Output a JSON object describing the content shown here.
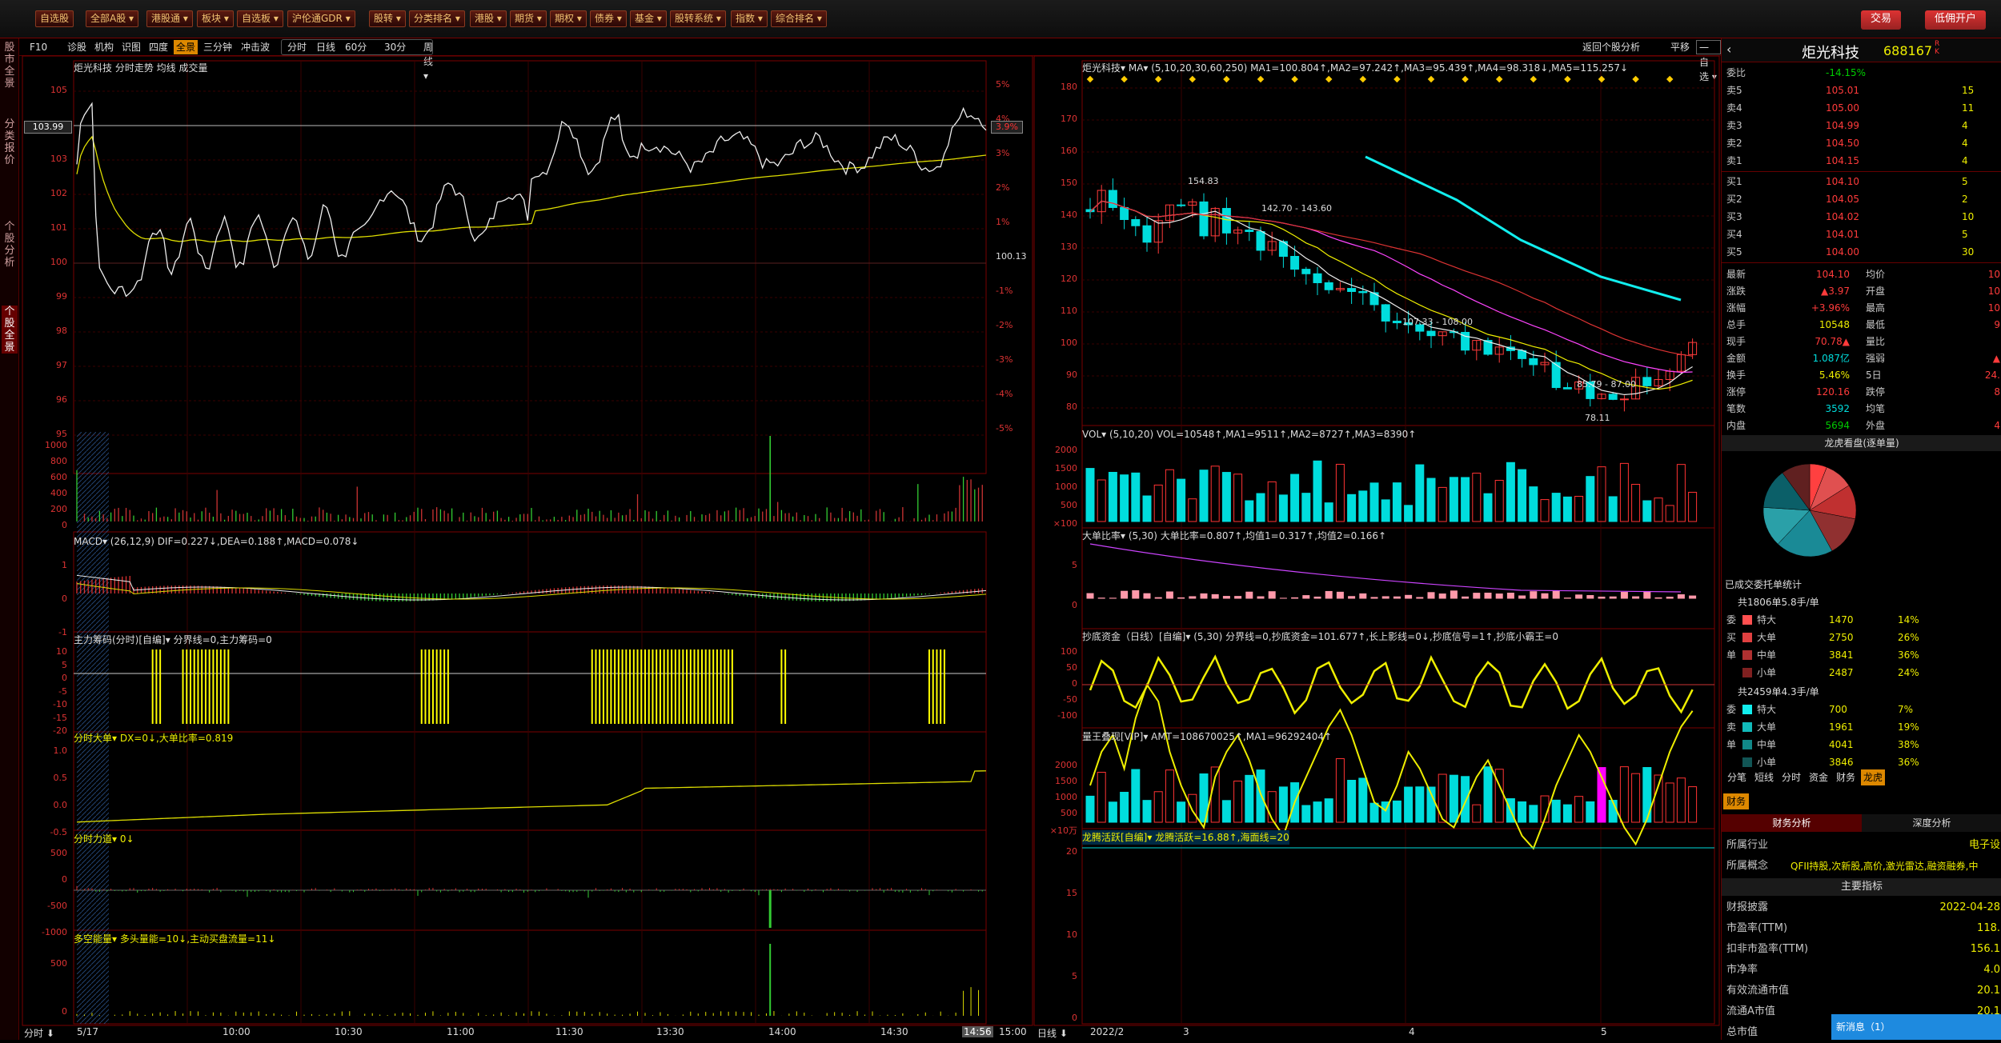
{
  "menu": [
    "自选股",
    "全部A股",
    "港股通",
    "板块",
    "自选板",
    "沪伦通GDR",
    "股转",
    "分类排名",
    "港股",
    "期货",
    "期权",
    "债券",
    "基金",
    "股转系统",
    "指数",
    "综合排名"
  ],
  "menu_right": [
    "交易",
    "低佣开户"
  ],
  "sidebar_tabs": [
    "股市全景",
    "分类报价",
    "个股分析",
    "个股全景"
  ],
  "toolbar_left": [
    "F10",
    "诊股",
    "机构",
    "识图",
    "四度",
    "全景",
    "三分钟",
    "冲击波"
  ],
  "toolbar_active": "全景",
  "toolbar_mid": [
    "分时",
    "日线",
    "60分",
    "30分",
    "周线"
  ],
  "toolbar_right": [
    "返回个股分析",
    "平移",
    "一自选"
  ],
  "stock": {
    "name": "炬光科技",
    "code": "688167",
    "badge": "R K"
  },
  "intraday": {
    "head": "炬光科技  分时走势  均线 成交量",
    "price_ticks": [
      "105",
      "104",
      "103",
      "102",
      "101",
      "100",
      "99",
      "98",
      "97",
      "96",
      "95"
    ],
    "pct_ticks": [
      "5%",
      "4%",
      "3%",
      "2%",
      "1%",
      "100.13",
      "-1%",
      "-2%",
      "-3%",
      "-4%",
      "-5%"
    ],
    "current": "103.99",
    "current_pct": "3.9%",
    "vol_ticks": [
      "1000",
      "800",
      "600",
      "400",
      "200",
      "0"
    ],
    "macd_head": "MACD▾ (26,12,9)  DIF=0.227↓,DEA=0.188↑,MACD=0.078↓",
    "macd_ticks": [
      "1",
      "0",
      "-1"
    ],
    "zlcm_head": "主力筹码(分时)[自编]▾  分界线=0,主力筹码=0",
    "zlcm_ticks": [
      "10",
      "5",
      "0",
      "-5",
      "-10",
      "-15",
      "-20"
    ],
    "dd_head": "分时大单▾  DX=0↓,大单比率=0.819",
    "dd_ticks": [
      "1.0",
      "0.5",
      "0.0",
      "-0.5"
    ],
    "ld_head": "分时力道▾  0↓",
    "ld_ticks": [
      "500",
      "0",
      "-500",
      "-1000"
    ],
    "dk_head": "多空能量▾  多头量能=10↓,主动买盘流量=11↓",
    "dk_ticks": [
      "500",
      "0"
    ],
    "xaxis": [
      "分时 ⬇",
      "5/17",
      "10:00",
      "10:30",
      "11:00",
      "11:30",
      "13:30",
      "14:00",
      "14:30",
      "14:56",
      "15:00"
    ]
  },
  "daily": {
    "head": "炬光科技▾  MA▾ (5,10,20,30,60,250)  MA1=100.804↑,MA2=97.242↑,MA3=95.439↑,MA4=98.318↓,MA5=115.257↓",
    "price_ticks": [
      "180",
      "170",
      "160",
      "150",
      "140",
      "130",
      "120",
      "110",
      "100",
      "90",
      "80"
    ],
    "annot": [
      "154.83",
      "142.70 - 143.60",
      "107.33 - 108.00",
      "85.79 - 87.00",
      "78.11"
    ],
    "vol_head": "VOL▾ (5,10,20)  VOL=10548↑,MA1=9511↑,MA2=8727↑,MA3=8390↑",
    "vol_ticks": [
      "2000",
      "1500",
      "1000",
      "500",
      "×100"
    ],
    "ddbl_head": "大单比率▾ (5,30)  大单比率=0.807↑,均值1=0.317↑,均值2=0.166↑",
    "ddbl_ticks": [
      "5",
      "0"
    ],
    "cdzj_head": "抄底资金（日线）[自编]▾ (5,30)  分界线=0,抄底资金=101.677↑,长上影线=0↓,抄底信号=1↑,抄底小霸王=0",
    "cdzj_ticks": [
      "100",
      "50",
      "0",
      "-50",
      "-100"
    ],
    "lw_head": "量王叠现[VIP]▾  AMT=108670025↑,MA1=96292404↑",
    "lw_ticks": [
      "2000",
      "1500",
      "1000",
      "500",
      "×10万"
    ],
    "lt_head": "龙腾活跃[自编]▾  龙腾活跃=16.88↑,海面线=20",
    "lt_ticks": [
      "20",
      "15",
      "10",
      "5",
      "0"
    ],
    "xaxis": [
      "日线 ⬇",
      "2022/2",
      "3",
      "4",
      "5"
    ]
  },
  "orderbook": {
    "weibi_label": "委比",
    "weibi": "-14.15%",
    "asks": [
      [
        "卖5",
        "105.01",
        "15"
      ],
      [
        "卖4",
        "105.00",
        "11"
      ],
      [
        "卖3",
        "104.99",
        "4"
      ],
      [
        "卖2",
        "104.50",
        "4"
      ],
      [
        "卖1",
        "104.15",
        "4"
      ]
    ],
    "bids": [
      [
        "买1",
        "104.10",
        "5"
      ],
      [
        "买2",
        "104.05",
        "2"
      ],
      [
        "买3",
        "104.02",
        "10"
      ],
      [
        "买4",
        "104.01",
        "5"
      ],
      [
        "买5",
        "104.00",
        "30"
      ]
    ]
  },
  "stats": [
    [
      "最新",
      "104.10",
      "均价",
      "10"
    ],
    [
      "涨跌",
      "▲3.97",
      "开盘",
      "10"
    ],
    [
      "涨幅",
      "+3.96%",
      "最高",
      "10"
    ],
    [
      "总手",
      "10548",
      "最低",
      "9"
    ],
    [
      "现手",
      "70.78▲",
      "量比",
      ""
    ],
    [
      "金额",
      "1.087亿",
      "强弱",
      "▲"
    ],
    [
      "换手",
      "5.46%",
      "5日",
      "24."
    ],
    [
      "涨停",
      "120.16",
      "跌停",
      "8"
    ],
    [
      "笔数",
      "3592",
      "均笔",
      ""
    ],
    [
      "内盘",
      "5694",
      "外盘",
      "4"
    ]
  ],
  "lhb_title": "龙虎看盘(逐单量)",
  "pie_colors": [
    "#ff4040",
    "#e05050",
    "#c03030",
    "#903030",
    "#1a8a96",
    "#2aa0a8",
    "#0b5f68",
    "#602020"
  ],
  "delegation": {
    "title": "已成交委托单统计",
    "buy_head": "共1806单5.8手/单",
    "sell_head": "共2459单4.3手/单",
    "buy": [
      [
        "委",
        "特大",
        "1470",
        "14%"
      ],
      [
        "买",
        "大单",
        "2750",
        "26%"
      ],
      [
        "单",
        "中单",
        "3841",
        "36%"
      ],
      [
        "",
        "小单",
        "2487",
        "24%"
      ]
    ],
    "sell": [
      [
        "委",
        "特大",
        "700",
        "7%"
      ],
      [
        "卖",
        "大单",
        "1961",
        "19%"
      ],
      [
        "单",
        "中单",
        "4041",
        "38%"
      ],
      [
        "",
        "小单",
        "3846",
        "36%"
      ]
    ]
  },
  "right_tabs": [
    "分笔",
    "短线",
    "分时",
    "资金",
    "财务",
    "龙虎"
  ],
  "finance": {
    "tab": "财务",
    "subtabs": [
      "财务分析",
      "深度分析"
    ],
    "industry_label": "所属行业",
    "industry": "电子设",
    "concept_label": "所属概念",
    "concept": "QFII持股,次新股,高价,激光雷达,融资融券,中",
    "main_title": "主要指标",
    "rows": [
      [
        "财报披露",
        "2022-04-28"
      ],
      [
        "市盈率(TTM)",
        "118."
      ],
      [
        "扣非市盈率(TTM)",
        "156.1"
      ],
      [
        "市净率",
        "4.0"
      ],
      [
        "有效流通市值",
        "20.1"
      ],
      [
        "流通A市值",
        "20.1"
      ],
      [
        "总市值",
        ""
      ]
    ]
  },
  "news": "新消息（1）"
}
